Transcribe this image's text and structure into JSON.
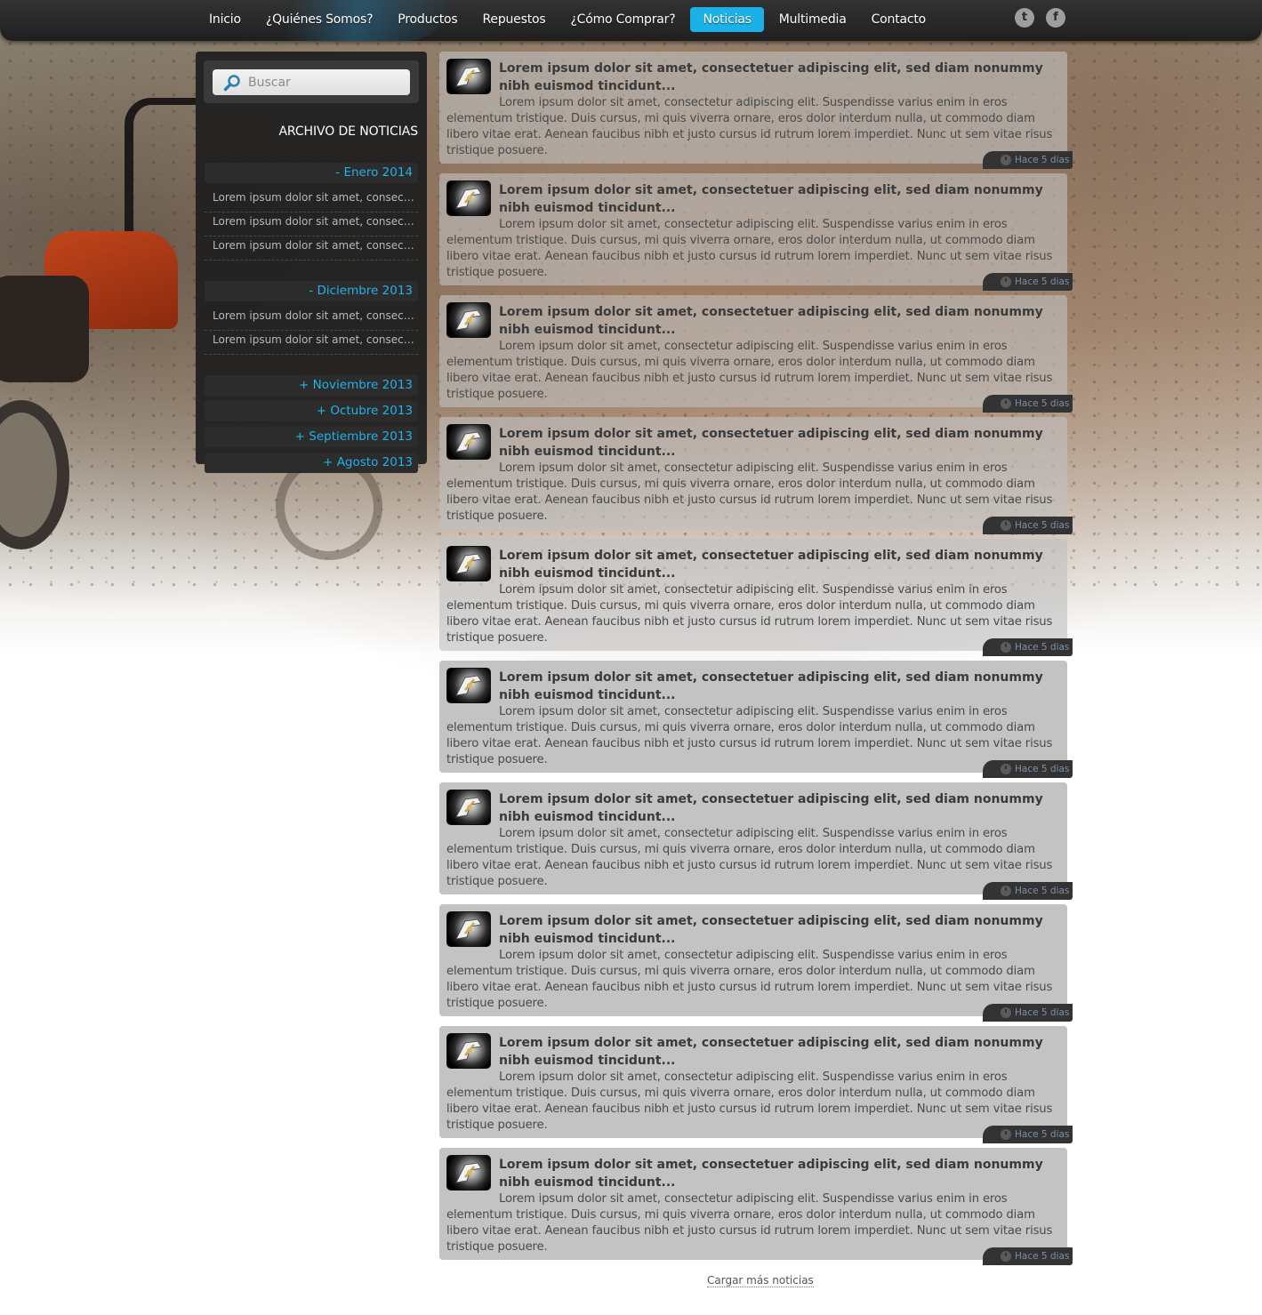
{
  "nav": {
    "items": [
      {
        "label": "Inicio",
        "active": false
      },
      {
        "label": "¿Quiénes Somos?",
        "active": false
      },
      {
        "label": "Productos",
        "active": false
      },
      {
        "label": "Repuestos",
        "active": false
      },
      {
        "label": "¿Cómo Comprar?",
        "active": false
      },
      {
        "label": "Noticias",
        "active": true
      },
      {
        "label": "Multimedia",
        "active": false
      },
      {
        "label": "Contacto",
        "active": false
      }
    ],
    "social": [
      {
        "icon": "twitter-icon",
        "glyph": "t"
      },
      {
        "icon": "facebook-icon",
        "glyph": "f"
      }
    ]
  },
  "sidebar": {
    "search_placeholder": "Buscar",
    "archive_title": "ARCHIVO DE NOTICIAS",
    "months": [
      {
        "label": "- Enero 2014",
        "items": [
          "Lorem ipsum dolor sit amet, consectetuer adipiscing elit",
          "Lorem ipsum dolor sit amet, consectetuer adipiscing elit",
          "Lorem ipsum dolor sit amet, consectetuer adipiscing elit"
        ]
      },
      {
        "label": "- Diciembre 2013",
        "items": [
          "Lorem ipsum dolor sit amet, consectetuer adipiscing elit",
          "Lorem ipsum dolor sit amet, consectetuer adipiscing elit"
        ]
      },
      {
        "label": "+ Noviembre 2013",
        "items": []
      },
      {
        "label": "+ Octubre 2013",
        "items": []
      },
      {
        "label": "+ Septiembre 2013",
        "items": []
      },
      {
        "label": "+ Agosto 2013",
        "items": []
      }
    ]
  },
  "news": [
    {
      "title": "Lorem ipsum dolor sit amet, consectetuer adipiscing elit, sed diam nonummy nibh euismod tincidunt...",
      "body": "Lorem ipsum dolor sit amet, consectetur adipiscing elit. Suspendisse varius enim in eros elementum tristique. Duis cursus, mi quis viverra ornare, eros dolor interdum nulla, ut commodo diam libero vitae erat. Aenean faucibus nibh et justo cursus id rutrum lorem imperdiet. Nunc ut sem vitae risus tristique posuere.",
      "time": "Hace 5 dias"
    },
    {
      "title": "Lorem ipsum dolor sit amet, consectetuer adipiscing elit, sed diam nonummy nibh euismod tincidunt...",
      "body": "Lorem ipsum dolor sit amet, consectetur adipiscing elit. Suspendisse varius enim in eros elementum tristique. Duis cursus, mi quis viverra ornare, eros dolor interdum nulla, ut commodo diam libero vitae erat. Aenean faucibus nibh et justo cursus id rutrum lorem imperdiet. Nunc ut sem vitae risus tristique posuere.",
      "time": "Hace 5 dias"
    },
    {
      "title": "Lorem ipsum dolor sit amet, consectetuer adipiscing elit, sed diam nonummy nibh euismod tincidunt...",
      "body": "Lorem ipsum dolor sit amet, consectetur adipiscing elit. Suspendisse varius enim in eros elementum tristique. Duis cursus, mi quis viverra ornare, eros dolor interdum nulla, ut commodo diam libero vitae erat. Aenean faucibus nibh et justo cursus id rutrum lorem imperdiet. Nunc ut sem vitae risus tristique posuere.",
      "time": "Hace 5 dias"
    },
    {
      "title": "Lorem ipsum dolor sit amet, consectetuer adipiscing elit, sed diam nonummy nibh euismod tincidunt...",
      "body": "Lorem ipsum dolor sit amet, consectetur adipiscing elit. Suspendisse varius enim in eros elementum tristique. Duis cursus, mi quis viverra ornare, eros dolor interdum nulla, ut commodo diam libero vitae erat. Aenean faucibus nibh et justo cursus id rutrum lorem imperdiet. Nunc ut sem vitae risus tristique posuere.",
      "time": "Hace 5 dias"
    },
    {
      "title": "Lorem ipsum dolor sit amet, consectetuer adipiscing elit, sed diam nonummy nibh euismod tincidunt...",
      "body": "Lorem ipsum dolor sit amet, consectetur adipiscing elit. Suspendisse varius enim in eros elementum tristique. Duis cursus, mi quis viverra ornare, eros dolor interdum nulla, ut commodo diam libero vitae erat. Aenean faucibus nibh et justo cursus id rutrum lorem imperdiet. Nunc ut sem vitae risus tristique posuere.",
      "time": "Hace 5 dias"
    },
    {
      "title": "Lorem ipsum dolor sit amet, consectetuer adipiscing elit, sed diam nonummy nibh euismod tincidunt...",
      "body": "Lorem ipsum dolor sit amet, consectetur adipiscing elit. Suspendisse varius enim in eros elementum tristique. Duis cursus, mi quis viverra ornare, eros dolor interdum nulla, ut commodo diam libero vitae erat. Aenean faucibus nibh et justo cursus id rutrum lorem imperdiet. Nunc ut sem vitae risus tristique posuere.",
      "time": "Hace 5 dias"
    },
    {
      "title": "Lorem ipsum dolor sit amet, consectetuer adipiscing elit, sed diam nonummy nibh euismod tincidunt...",
      "body": "Lorem ipsum dolor sit amet, consectetur adipiscing elit. Suspendisse varius enim in eros elementum tristique. Duis cursus, mi quis viverra ornare, eros dolor interdum nulla, ut commodo diam libero vitae erat. Aenean faucibus nibh et justo cursus id rutrum lorem imperdiet. Nunc ut sem vitae risus tristique posuere.",
      "time": "Hace 5 dias"
    },
    {
      "title": "Lorem ipsum dolor sit amet, consectetuer adipiscing elit, sed diam nonummy nibh euismod tincidunt...",
      "body": "Lorem ipsum dolor sit amet, consectetur adipiscing elit. Suspendisse varius enim in eros elementum tristique. Duis cursus, mi quis viverra ornare, eros dolor interdum nulla, ut commodo diam libero vitae erat. Aenean faucibus nibh et justo cursus id rutrum lorem imperdiet. Nunc ut sem vitae risus tristique posuere.",
      "time": "Hace 5 dias"
    },
    {
      "title": "Lorem ipsum dolor sit amet, consectetuer adipiscing elit, sed diam nonummy nibh euismod tincidunt...",
      "body": "Lorem ipsum dolor sit amet, consectetur adipiscing elit. Suspendisse varius enim in eros elementum tristique. Duis cursus, mi quis viverra ornare, eros dolor interdum nulla, ut commodo diam libero vitae erat. Aenean faucibus nibh et justo cursus id rutrum lorem imperdiet. Nunc ut sem vitae risus tristique posuere.",
      "time": "Hace 5 dias"
    },
    {
      "title": "Lorem ipsum dolor sit amet, consectetuer adipiscing elit, sed diam nonummy nibh euismod tincidunt...",
      "body": "Lorem ipsum dolor sit amet, consectetur adipiscing elit. Suspendisse varius enim in eros elementum tristique. Duis cursus, mi quis viverra ornare, eros dolor interdum nulla, ut commodo diam libero vitae erat. Aenean faucibus nibh et justo cursus id rutrum lorem imperdiet. Nunc ut sem vitae risus tristique posuere.",
      "time": "Hace 5 dias"
    }
  ],
  "load_more_label": "Cargar más noticias",
  "colors": {
    "accent": "#1bb0e6",
    "nav_bg": "#262626",
    "sidebar_bg": "#1e1e1e",
    "card_bg": "#c3c3c3",
    "time_text": "#7f8fa8"
  }
}
